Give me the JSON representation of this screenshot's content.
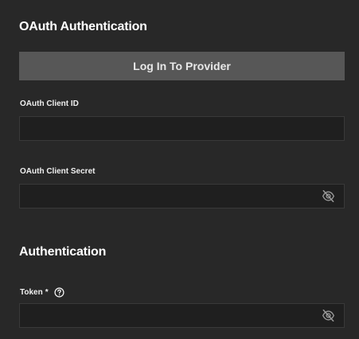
{
  "oauth": {
    "title": "OAuth Authentication",
    "login_button_label": "Log In To Provider",
    "client_id": {
      "label": "OAuth Client ID",
      "value": "",
      "placeholder": ""
    },
    "client_secret": {
      "label": "OAuth Client Secret",
      "value": "",
      "placeholder": ""
    }
  },
  "auth": {
    "title": "Authentication",
    "token": {
      "label": "Token",
      "required_mark": "*",
      "value": "",
      "placeholder": ""
    }
  },
  "icons": {
    "visibility_toggle": "eye-off-icon",
    "help": "help-circle-icon"
  },
  "colors": {
    "background": "#282828",
    "button": "#575757",
    "field_background": "#1f1f1f",
    "field_border": "#393939",
    "icon": "#9a9a9a"
  }
}
